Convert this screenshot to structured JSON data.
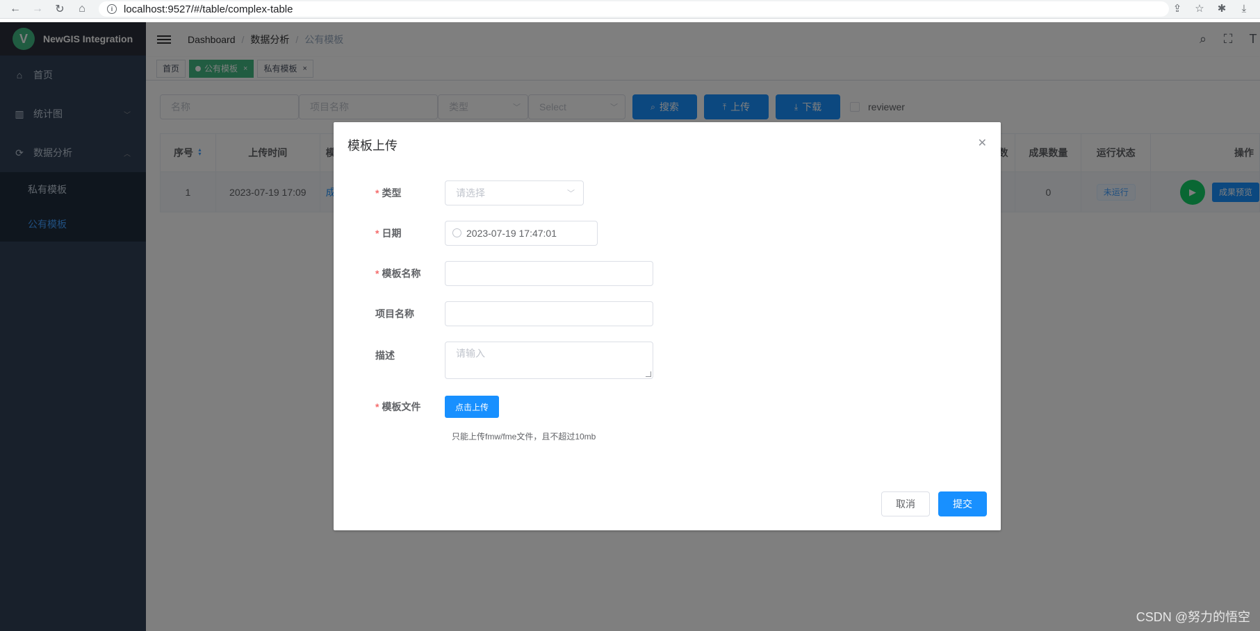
{
  "browser": {
    "url": "localhost:9527/#/table/complex-table"
  },
  "sidebar": {
    "logo_letter": "V",
    "title": "NewGIS Integration",
    "items": [
      {
        "label": "首页"
      },
      {
        "label": "统计图"
      },
      {
        "label": "数据分析"
      }
    ],
    "sub_items": [
      {
        "label": "私有模板"
      },
      {
        "label": "公有模板"
      }
    ]
  },
  "header": {
    "breadcrumb": [
      "Dashboard",
      "数据分析",
      "公有模板"
    ]
  },
  "tags": [
    {
      "label": "首页"
    },
    {
      "label": "公有模板"
    },
    {
      "label": "私有模板"
    }
  ],
  "filter": {
    "name_placeholder": "名称",
    "project_placeholder": "项目名称",
    "type_placeholder": "类型",
    "select_placeholder": "Select",
    "search_label": "搜索",
    "upload_label": "上传",
    "download_label": "下载",
    "reviewer_label": "reviewer"
  },
  "table": {
    "headers": [
      "序号",
      "上传时间",
      "模",
      "数",
      "成果数量",
      "运行状态",
      "操作"
    ],
    "row": {
      "index": "1",
      "time": "2023-07-19 17:09",
      "name_partial": "成",
      "result_count": "0",
      "status": "未运行",
      "preview_label": "成果预览"
    }
  },
  "dialog": {
    "title": "模板上传",
    "type_label": "类型",
    "type_placeholder": "请选择",
    "date_label": "日期",
    "date_value": "2023-07-19 17:47:01",
    "template_name_label": "模板名称",
    "project_name_label": "项目名称",
    "desc_label": "描述",
    "desc_placeholder": "请输入",
    "file_label": "模板文件",
    "upload_button": "点击上传",
    "upload_tip": "只能上传fmw/fme文件，且不超过10mb",
    "cancel": "取消",
    "submit": "提交"
  },
  "watermark": "CSDN @努力的悟空",
  "colors": {
    "primary": "#1890ff",
    "sidebar_bg": "#304156",
    "tag_active": "#42b983",
    "play": "#13ce66",
    "required": "#f56c6c"
  }
}
